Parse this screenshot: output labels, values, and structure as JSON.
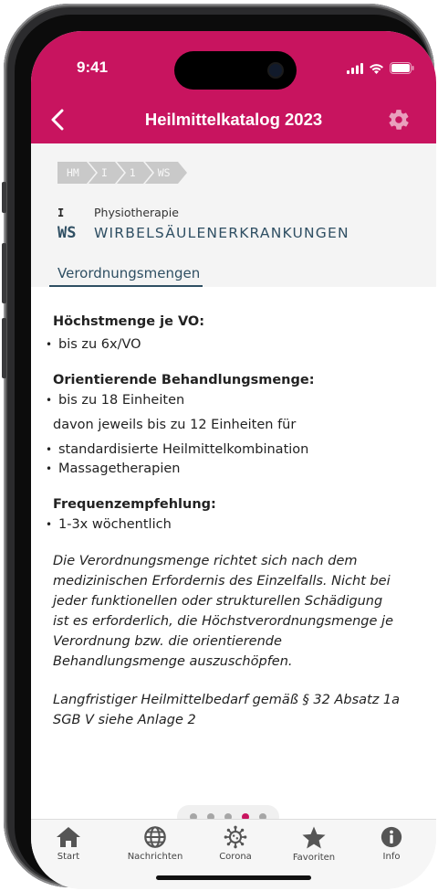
{
  "status_bar": {
    "time": "9:41"
  },
  "nav": {
    "title": "Heilmittelkatalog 2023",
    "back_icon": "chevron-left-icon",
    "settings_icon": "gear-icon"
  },
  "breadcrumb": [
    "HM",
    "I",
    "1",
    "WS"
  ],
  "category": {
    "code": "I",
    "label": "Physiotherapie"
  },
  "subcategory": {
    "code": "WS",
    "label": "WIRBELSÄULENERKRANKUNGEN"
  },
  "tab": {
    "label": "Verordnungsmengen"
  },
  "content": {
    "max_heading": "Höchstmenge je VO:",
    "max_item": "bis zu 6x/VO",
    "orient_heading": "Orientierende Behandlungsmenge:",
    "orient_item": "bis zu 18 Einheiten",
    "orient_note": "davon jeweils bis zu 12 Einheiten für",
    "orient_sub_items": [
      "standardisierte Heilmittelkombination",
      "Massagetherapien"
    ],
    "freq_heading": "Frequenzempfehlung:",
    "freq_item": "1-3x wöchentlich",
    "note_lines": [
      "Die Verordnungsmenge richtet sich nach dem",
      "medizinischen Erfordernis des Einzelfalls. Nicht bei",
      "jeder funktionellen oder strukturellen Schädigung",
      "ist es erforderlich, die Höchstverordnungsmenge je",
      "Verordnung bzw. die orientierende",
      "Behandlungsmenge auszuschöpfen."
    ],
    "note2_lines": [
      "Langfristiger Heilmittelbedarf gemäß § 32 Absatz 1a",
      "SGB V siehe Anlage 2"
    ]
  },
  "pager": {
    "total": 5,
    "active_index": 3
  },
  "tabbar": {
    "items": [
      {
        "label": "Start",
        "icon": "home-icon"
      },
      {
        "label": "Nachrichten",
        "icon": "globe-icon"
      },
      {
        "label": "Corona",
        "icon": "virus-icon"
      },
      {
        "label": "Favoriten",
        "icon": "star-icon"
      },
      {
        "label": "Info",
        "icon": "info-icon"
      }
    ]
  },
  "colors": {
    "brand": "#c8145f",
    "accent_text": "#2f4f63",
    "crumb_bg": "#c9c9c9"
  }
}
